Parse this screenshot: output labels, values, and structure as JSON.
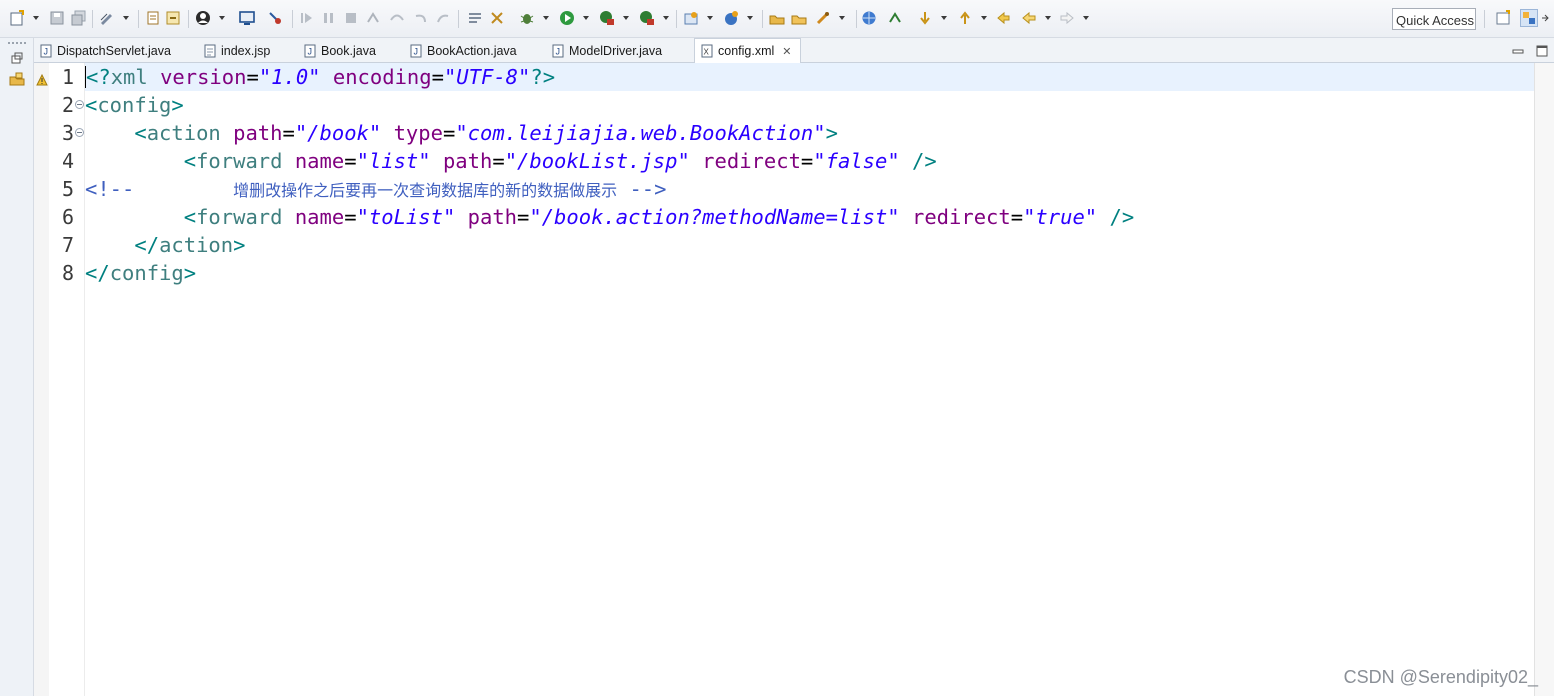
{
  "toolbar": {
    "quick_access_placeholder": "Quick Access",
    "icons": [
      "new-wizard-icon",
      "save-icon",
      "save-all-icon",
      "edit-icon",
      "skip-breakpoints-icon",
      "build-icon",
      "user-icon",
      "console-icon",
      "resume-icon",
      "suspend-icon",
      "terminate-icon",
      "disconnect-icon",
      "step-into-icon",
      "step-over-icon",
      "step-return-icon",
      "debug-icon",
      "run-icon",
      "coverage-icon",
      "external-tools-icon",
      "new-server-icon",
      "open-type-icon",
      "open-task-icon",
      "search-icon",
      "browser-icon",
      "next-annotation-icon",
      "prev-annotation-icon",
      "last-edit-icon",
      "back-icon",
      "forward-icon",
      "open-perspective-icon",
      "java-ee-perspective-icon"
    ]
  },
  "tabs": [
    {
      "label": "DispatchServlet.java",
      "icon": "java-file-icon",
      "active": false
    },
    {
      "label": "index.jsp",
      "icon": "jsp-file-icon",
      "active": false
    },
    {
      "label": "Book.java",
      "icon": "java-file-icon",
      "active": false
    },
    {
      "label": "BookAction.java",
      "icon": "java-file-icon",
      "active": false
    },
    {
      "label": "ModelDriver.java",
      "icon": "java-file-icon",
      "active": false
    },
    {
      "label": "config.xml",
      "icon": "xml-file-icon",
      "active": true,
      "close": "✕"
    }
  ],
  "editor": {
    "file": "config.xml",
    "current_line": 1,
    "line_numbers": [
      "1",
      "2",
      "3",
      "4",
      "5",
      "6",
      "7",
      "8"
    ],
    "lines": [
      {
        "segments": [
          {
            "t": "<?",
            "c": "punc"
          },
          {
            "t": "xml",
            "c": "tag"
          },
          {
            "t": " ",
            "c": ""
          },
          {
            "t": "version",
            "c": "attr"
          },
          {
            "t": "=",
            "c": ""
          },
          {
            "t": "\"1.0\"",
            "c": "str"
          },
          {
            "t": " ",
            "c": ""
          },
          {
            "t": "encoding",
            "c": "attr"
          },
          {
            "t": "=",
            "c": ""
          },
          {
            "t": "\"UTF-8\"",
            "c": "str"
          },
          {
            "t": "?>",
            "c": "punc"
          }
        ]
      },
      {
        "segments": [
          {
            "t": "<",
            "c": "punc"
          },
          {
            "t": "config",
            "c": "tag"
          },
          {
            "t": ">",
            "c": "punc"
          }
        ]
      },
      {
        "segments": [
          {
            "t": "    ",
            "c": ""
          },
          {
            "t": "<",
            "c": "punc"
          },
          {
            "t": "action",
            "c": "tag"
          },
          {
            "t": " ",
            "c": ""
          },
          {
            "t": "path",
            "c": "attr"
          },
          {
            "t": "=",
            "c": ""
          },
          {
            "t": "\"/book\"",
            "c": "str"
          },
          {
            "t": " ",
            "c": ""
          },
          {
            "t": "type",
            "c": "attr"
          },
          {
            "t": "=",
            "c": ""
          },
          {
            "t": "\"com.leijiajia.web.BookAction\"",
            "c": "str"
          },
          {
            "t": ">",
            "c": "punc"
          }
        ]
      },
      {
        "segments": [
          {
            "t": "        ",
            "c": ""
          },
          {
            "t": "<",
            "c": "punc"
          },
          {
            "t": "forward",
            "c": "tag"
          },
          {
            "t": " ",
            "c": ""
          },
          {
            "t": "name",
            "c": "attr"
          },
          {
            "t": "=",
            "c": ""
          },
          {
            "t": "\"list\"",
            "c": "str"
          },
          {
            "t": " ",
            "c": ""
          },
          {
            "t": "path",
            "c": "attr"
          },
          {
            "t": "=",
            "c": ""
          },
          {
            "t": "\"/bookList.jsp\"",
            "c": "str"
          },
          {
            "t": " ",
            "c": ""
          },
          {
            "t": "redirect",
            "c": "attr"
          },
          {
            "t": "=",
            "c": ""
          },
          {
            "t": "\"false\"",
            "c": "str"
          },
          {
            "t": " ",
            "c": ""
          },
          {
            "t": "/>",
            "c": "punc"
          }
        ]
      },
      {
        "segments": [
          {
            "t": "<!--        ",
            "c": "cmt"
          },
          {
            "t": "增删改操作之后要再一次查询数据库的新的数据做展示",
            "c": "cmt-cjk"
          },
          {
            "t": " -->",
            "c": "cmt"
          }
        ]
      },
      {
        "segments": [
          {
            "t": "        ",
            "c": ""
          },
          {
            "t": "<",
            "c": "punc"
          },
          {
            "t": "forward",
            "c": "tag"
          },
          {
            "t": " ",
            "c": ""
          },
          {
            "t": "name",
            "c": "attr"
          },
          {
            "t": "=",
            "c": ""
          },
          {
            "t": "\"toList\"",
            "c": "str"
          },
          {
            "t": " ",
            "c": ""
          },
          {
            "t": "path",
            "c": "attr"
          },
          {
            "t": "=",
            "c": ""
          },
          {
            "t": "\"/book.action?methodName=list\"",
            "c": "str"
          },
          {
            "t": " ",
            "c": ""
          },
          {
            "t": "redirect",
            "c": "attr"
          },
          {
            "t": "=",
            "c": ""
          },
          {
            "t": "\"true\"",
            "c": "str"
          },
          {
            "t": " ",
            "c": ""
          },
          {
            "t": "/>",
            "c": "punc"
          }
        ]
      },
      {
        "segments": [
          {
            "t": "    ",
            "c": ""
          },
          {
            "t": "</",
            "c": "punc"
          },
          {
            "t": "action",
            "c": "tag"
          },
          {
            "t": ">",
            "c": "punc"
          }
        ]
      },
      {
        "segments": [
          {
            "t": "</",
            "c": "punc"
          },
          {
            "t": "config",
            "c": "tag"
          },
          {
            "t": ">",
            "c": "punc"
          }
        ]
      }
    ],
    "fold_lines": [
      2,
      3
    ],
    "warning_line": 1
  },
  "colors": {
    "tag": "#3f7f7f",
    "attribute": "#7f007f",
    "string": "#2a00ff",
    "comment": "#3f5fbf",
    "current_line": "#e8f2fe"
  },
  "watermark": "CSDN @Serendipity02_"
}
